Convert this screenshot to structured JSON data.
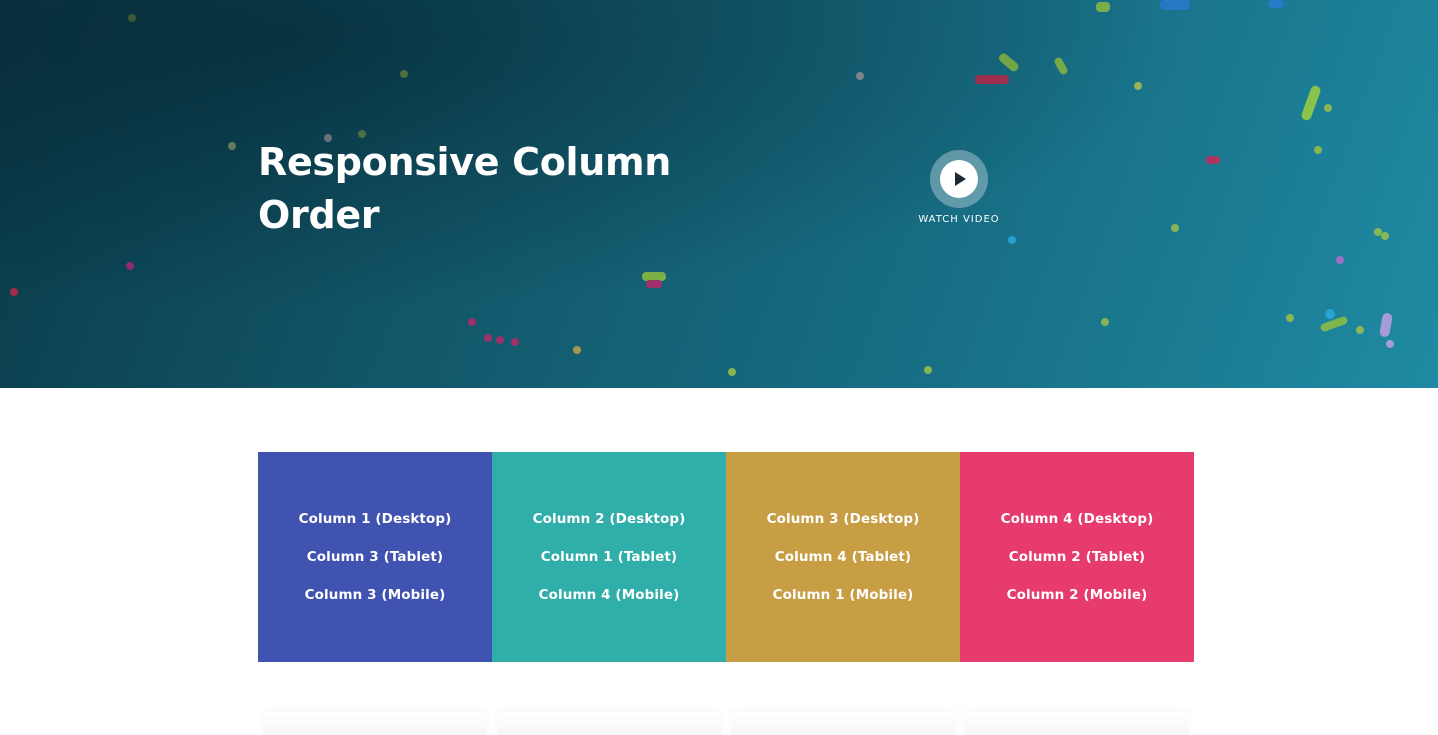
{
  "hero": {
    "title": "Responsive Column Order",
    "watch_video_label": "WATCH VIDEO"
  },
  "columns": [
    {
      "color": "#4153b0",
      "lines": [
        "Column 1 (Desktop)",
        "Column 3 (Tablet)",
        "Column 3 (Mobile)"
      ]
    },
    {
      "color": "#30aea9",
      "lines": [
        "Column 2 (Desktop)",
        "Column 1 (Tablet)",
        "Column 4 (Mobile)"
      ]
    },
    {
      "color": "#c89e45",
      "lines": [
        "Column 3 (Desktop)",
        "Column 4 (Tablet)",
        "Column 1 (Mobile)"
      ]
    },
    {
      "color": "#e63b6c",
      "lines": [
        "Column 4 (Desktop)",
        "Column 2 (Tablet)",
        "Column 2 (Mobile)"
      ]
    }
  ],
  "icons": {
    "play": "play-icon"
  }
}
